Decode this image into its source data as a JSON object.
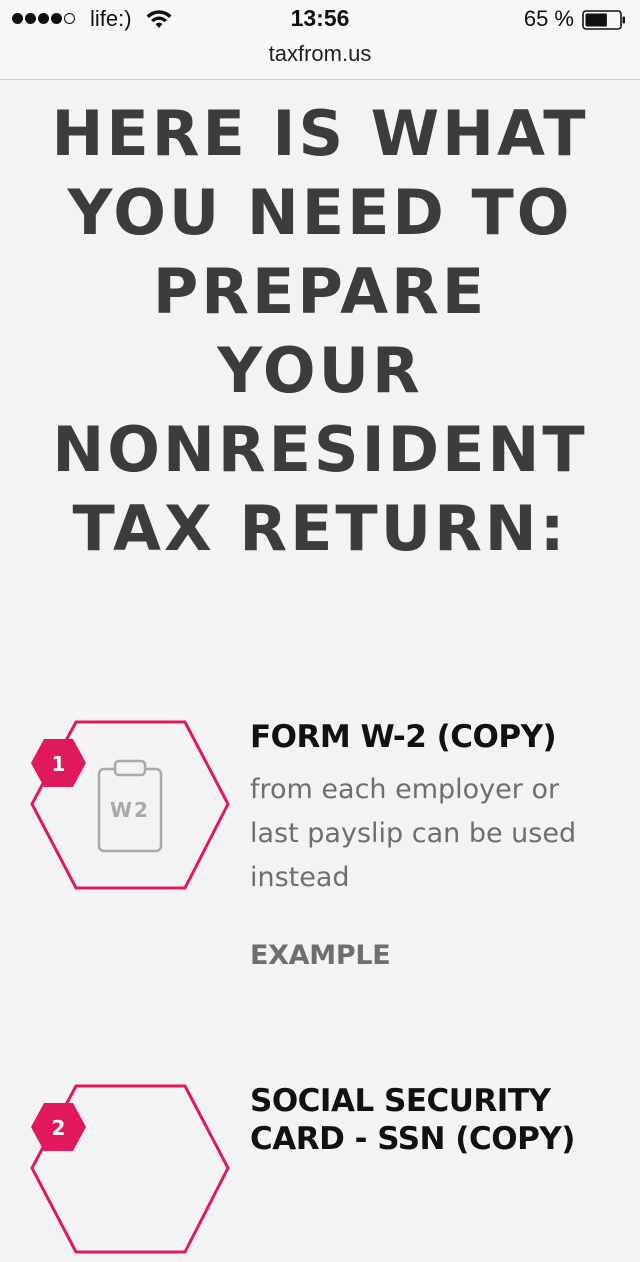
{
  "status_bar": {
    "carrier": "life:)",
    "time": "13:56",
    "battery_percent": "65 %",
    "battery_level": 0.65,
    "signal_bars_filled": 4,
    "signal_bars_total": 5,
    "url": "taxfrom.us"
  },
  "headline": {
    "lines": [
      "HERE IS WHAT",
      "YOU NEED TO",
      "PREPARE",
      "YOUR",
      "NONRESIDENT",
      "TAX RETURN:"
    ]
  },
  "items": [
    {
      "number": "1",
      "icon_label": "W2",
      "icon": "clipboard-icon",
      "title": "FORM W-2 (COPY)",
      "description_lines": [
        "from each employer or",
        "last payslip can be used",
        "instead"
      ],
      "link": "EXAMPLE"
    },
    {
      "number": "2",
      "title_lines": [
        "SOCIAL SECURITY",
        "CARD - SSN (COPY)"
      ]
    }
  ],
  "colors": {
    "accent": "#e0195a",
    "heading": "#3c3c3c",
    "body_text": "#6e6e6e",
    "background": "#f3f3f3"
  }
}
